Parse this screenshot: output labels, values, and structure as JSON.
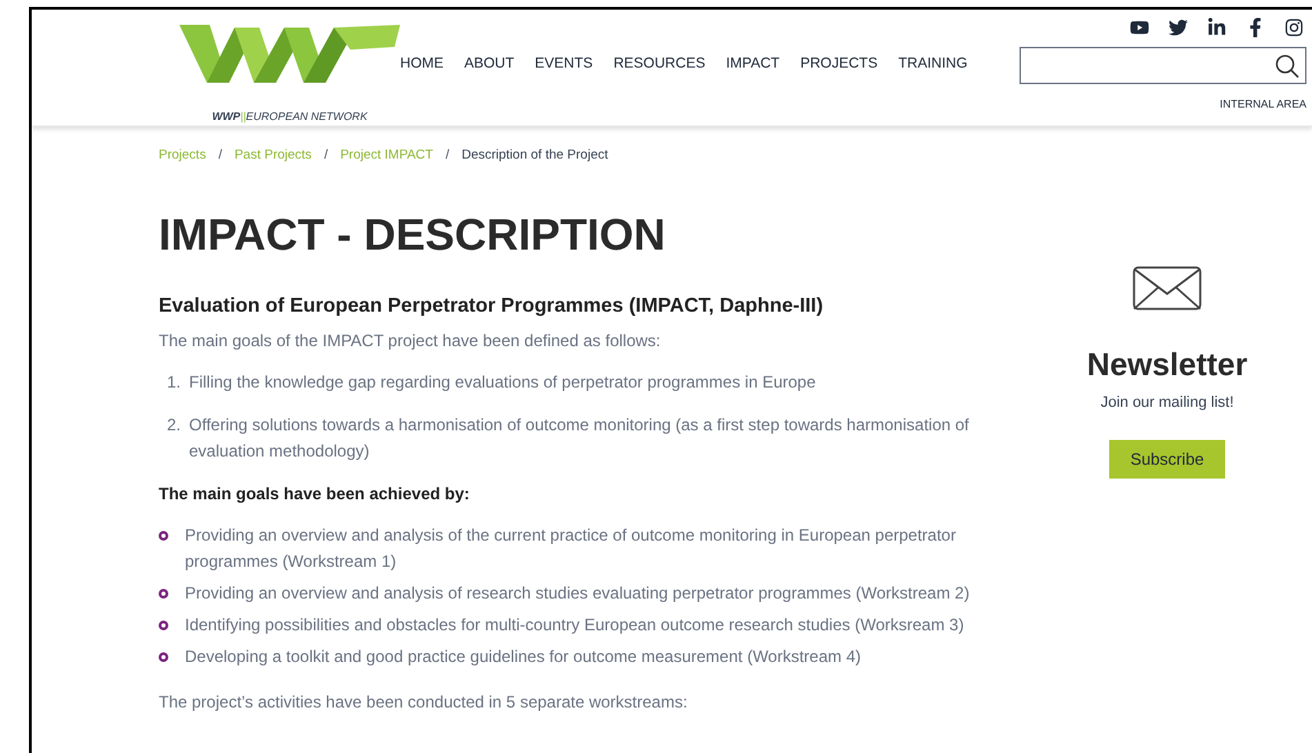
{
  "logo": {
    "tagline_bold": "WWP",
    "tagline_sep": "||",
    "tagline_rest": "EUROPEAN NETWORK"
  },
  "nav": [
    "HOME",
    "ABOUT",
    "EVENTS",
    "RESOURCES",
    "IMPACT",
    "PROJECTS",
    "TRAINING"
  ],
  "internal_area": "INTERNAL AREA",
  "breadcrumb_separator": "/",
  "breadcrumb": [
    {
      "label": "Projects",
      "kind": "link"
    },
    {
      "label": "Past Projects",
      "kind": "link"
    },
    {
      "label": "Project IMPACT",
      "kind": "link"
    },
    {
      "label": "Description of the Project",
      "kind": "current"
    }
  ],
  "title": "IMPACT - DESCRIPTION",
  "subtitle": "Evaluation of European Perpetrator Programmes (IMPACT, Daphne-III)",
  "intro": "The main goals of the IMPACT project have been defined as follows:",
  "goals": [
    {
      "number": "1.",
      "text": "Filling the knowledge gap regarding evaluations of perpetrator programmes in Europe"
    },
    {
      "number": "2.",
      "text": "Offering solutions towards a harmonisation of outcome monitoring (as a first step towards harmonisation of evaluation methodology)"
    }
  ],
  "achieved_heading": "The main goals have been achieved by:",
  "achievements": [
    "Providing an overview and analysis of the current practice of outcome monitoring in European perpetrator programmes (Workstream 1)",
    "Providing an overview and analysis of research studies evaluating perpetrator programmes (Workstream 2)",
    "Identifying possibilities and obstacles for multi-country European outcome research studies (Worksream 3)",
    "Developing a toolkit and good practice guidelines for outcome measurement (Workstream 4)"
  ],
  "closing": "The project’s activities have been conducted in 5 separate workstreams:",
  "newsletter": {
    "title": "Newsletter",
    "text": "Join our mailing list!",
    "button": "Subscribe"
  }
}
